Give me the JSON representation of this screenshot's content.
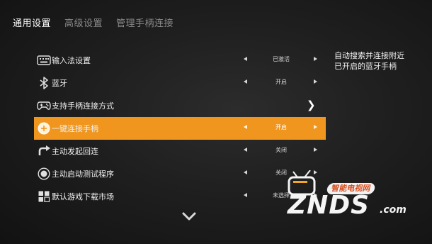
{
  "tabs": [
    {
      "label": "通用设置",
      "active": true
    },
    {
      "label": "高级设置",
      "active": false
    },
    {
      "label": "管理手柄连接",
      "active": false
    }
  ],
  "settings": [
    {
      "label": "输入法设置",
      "value": "已激活",
      "icon": "keyboard-icon",
      "type": "toggle"
    },
    {
      "label": "蓝牙",
      "value": "开启",
      "icon": "bluetooth-icon",
      "type": "toggle"
    },
    {
      "label": "支持手柄连接方式",
      "value": "",
      "icon": "gamepad-icon",
      "type": "navigate"
    },
    {
      "label": "一键连接手柄",
      "value": "开启",
      "icon": "gamepad-connect-icon",
      "type": "toggle",
      "selected": true
    },
    {
      "label": "主动发起回连",
      "value": "关闭",
      "icon": "reconnect-icon",
      "type": "toggle"
    },
    {
      "label": "主动启动测试程序",
      "value": "关闭",
      "icon": "test-program-icon",
      "type": "toggle"
    },
    {
      "label": "默认游戏下载市场",
      "value": "未选择",
      "icon": "market-icon",
      "type": "toggle"
    }
  ],
  "description": {
    "line1": "自动搜索并连接附近",
    "line2": "已开启的蓝牙手柄"
  },
  "watermark": {
    "top": "智能电视网",
    "main": "ZNDS",
    "suffix": ".com"
  },
  "colors": {
    "accent": "#f0961e",
    "background": "#1f1f1f",
    "tab_inactive": "#8a8a8a"
  }
}
